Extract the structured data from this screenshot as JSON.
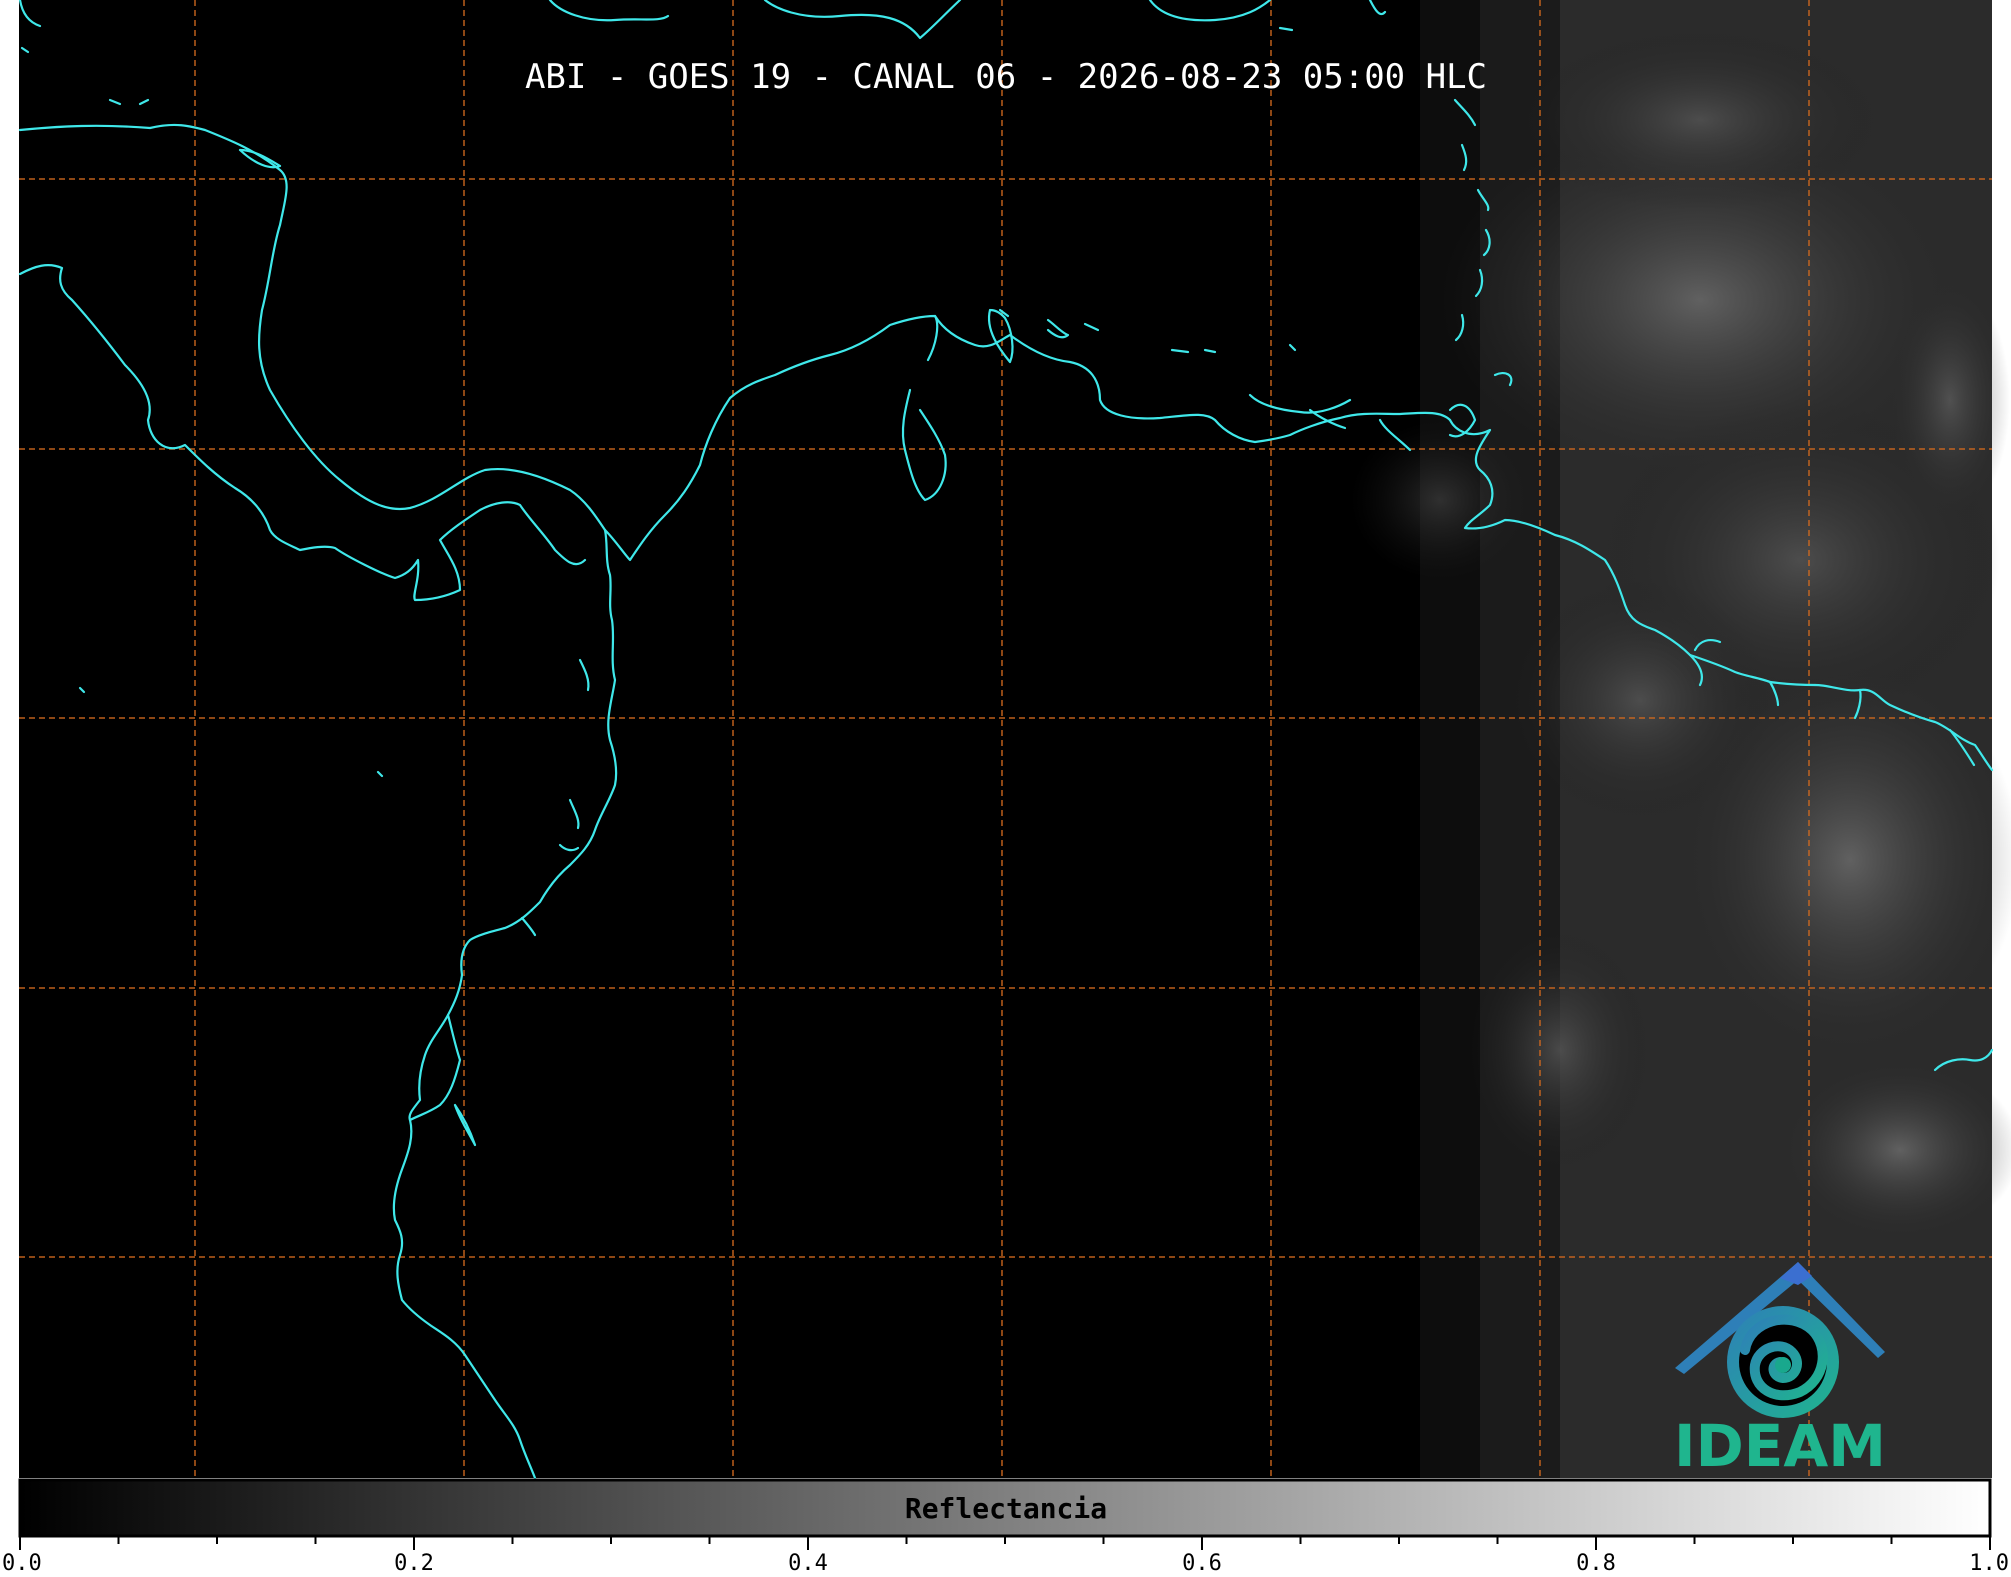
{
  "title": "ABI - GOES 19 - CANAL 06 - 2026-08-23 05:00 HLC",
  "colorbar": {
    "label": "Reflectancia",
    "ticks": [
      "0.0",
      "0.2",
      "0.4",
      "0.6",
      "0.8",
      "1.0"
    ],
    "range": [
      0.0,
      1.0
    ],
    "colormap": [
      "#000000",
      "#ffffff"
    ]
  },
  "logo": {
    "text": "IDEAM",
    "colors": {
      "roof": "#2e7fb8",
      "swirl": "#19a88d",
      "text": "#1fb58e"
    }
  },
  "colors": {
    "background": "#000000",
    "coastline": "#3fe8ea",
    "graticule": "#d2691e"
  }
}
